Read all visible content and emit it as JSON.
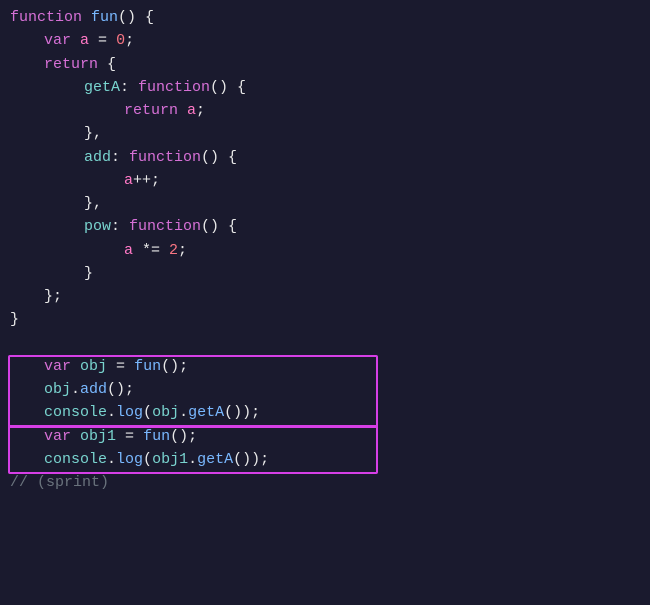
{
  "code": {
    "lines": [
      {
        "id": "line1",
        "content": "function fun() {"
      },
      {
        "id": "line2",
        "content": "    var a = 0;",
        "indent": 1
      },
      {
        "id": "line3",
        "content": "    return {",
        "indent": 1
      },
      {
        "id": "line4",
        "content": "        getA: function() {",
        "indent": 2
      },
      {
        "id": "line5",
        "content": "            return a;",
        "indent": 3
      },
      {
        "id": "line6",
        "content": "        },",
        "indent": 2
      },
      {
        "id": "line7",
        "content": "        add: function() {",
        "indent": 2
      },
      {
        "id": "line8",
        "content": "            a++;",
        "indent": 3
      },
      {
        "id": "line9",
        "content": "        },",
        "indent": 2
      },
      {
        "id": "line10",
        "content": "        pow: function() {",
        "indent": 2
      },
      {
        "id": "line11",
        "content": "            a *= 2;",
        "indent": 3
      },
      {
        "id": "line12",
        "content": "        }",
        "indent": 2
      },
      {
        "id": "line13",
        "content": "    };",
        "indent": 1
      },
      {
        "id": "line14",
        "content": "}"
      },
      {
        "id": "line15",
        "content": ""
      },
      {
        "id": "line16",
        "content": "    var obj = fun();",
        "highlight": "box1"
      },
      {
        "id": "line17",
        "content": "    obj.add();",
        "highlight": "box1"
      },
      {
        "id": "line18",
        "content": "    console.log(obj.getA());",
        "highlight": "box1"
      },
      {
        "id": "line19",
        "content": "    var obj1 = fun();",
        "highlight": "box2"
      },
      {
        "id": "line20",
        "content": "    console.log(obj1.getA());",
        "highlight": "box2"
      },
      {
        "id": "line21",
        "content": "// (sprint)"
      }
    ],
    "highlight_boxes": [
      {
        "id": "box1",
        "label": "highlight-box-1"
      },
      {
        "id": "box2",
        "label": "highlight-box-2"
      }
    ]
  }
}
